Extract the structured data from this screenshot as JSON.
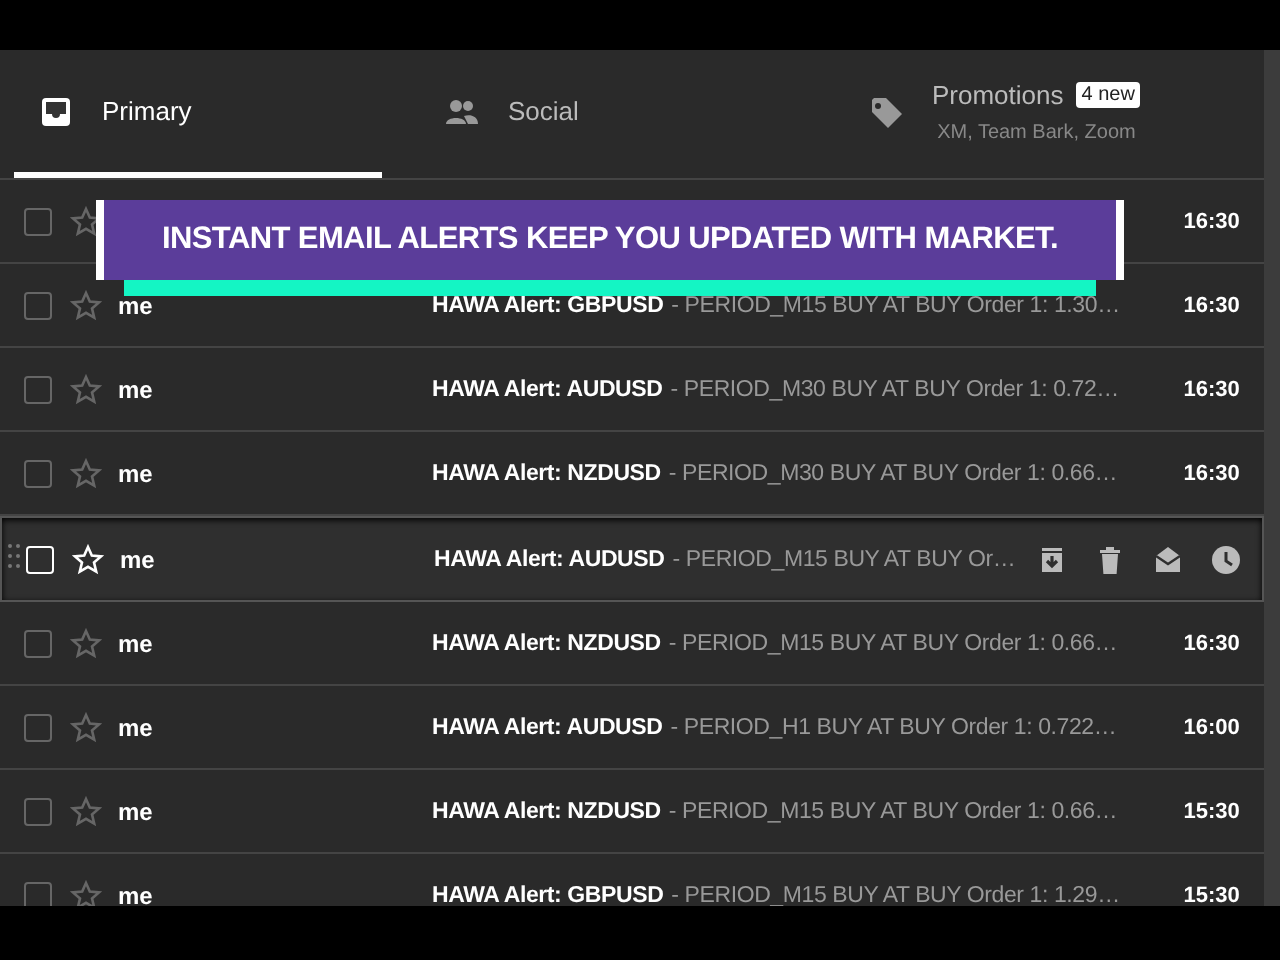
{
  "tabs": [
    {
      "label": "Primary",
      "kind": "inbox",
      "selected": true
    },
    {
      "label": "Social",
      "kind": "people",
      "selected": false
    },
    {
      "label": "Promotions",
      "kind": "tag",
      "selected": false,
      "badge": "4 new",
      "subtitle": "XM, Team Bark, Zoom"
    }
  ],
  "banner": {
    "text": "INSTANT EMAIL ALERTS KEEP YOU UPDATED WITH MARKET."
  },
  "emails": [
    {
      "time": "16:30",
      "hovered": false,
      "checked": false,
      "starred": false
    },
    {
      "sender": "me",
      "subject": "HAWA Alert: GBPUSD",
      "snippet": "- PERIOD_M15 BUY AT BUY Order 1: 1.30…",
      "time": "16:30",
      "hovered": false,
      "checked": false,
      "starred": false
    },
    {
      "sender": "me",
      "subject": "HAWA Alert: AUDUSD",
      "snippet": "- PERIOD_M30 BUY AT BUY Order 1: 0.72…",
      "time": "16:30",
      "hovered": false,
      "checked": false,
      "starred": false
    },
    {
      "sender": "me",
      "subject": "HAWA Alert: NZDUSD",
      "snippet": "- PERIOD_M30 BUY AT BUY Order 1: 0.66…",
      "time": "16:30",
      "hovered": false,
      "checked": false,
      "starred": false
    },
    {
      "sender": "me",
      "subject": "HAWA Alert: AUDUSD",
      "snippet": "- PERIOD_M15 BUY AT BUY Or…",
      "hovered": true,
      "checked": false,
      "starred": false
    },
    {
      "sender": "me",
      "subject": "HAWA Alert: NZDUSD",
      "snippet": "- PERIOD_M15 BUY AT BUY Order 1: 0.66…",
      "time": "16:30",
      "hovered": false,
      "checked": false,
      "starred": false
    },
    {
      "sender": "me",
      "subject": "HAWA Alert: AUDUSD",
      "snippet": "- PERIOD_H1 BUY AT BUY Order 1: 0.722…",
      "time": "16:00",
      "hovered": false,
      "checked": false,
      "starred": false
    },
    {
      "sender": "me",
      "subject": "HAWA Alert: NZDUSD",
      "snippet": "- PERIOD_M15 BUY AT BUY Order 1: 0.66…",
      "time": "15:30",
      "hovered": false,
      "checked": false,
      "starred": false
    },
    {
      "sender": "me",
      "subject": "HAWA Alert: GBPUSD",
      "snippet": "- PERIOD_M15 BUY AT BUY Order 1: 1.29…",
      "time": "15:30",
      "hovered": false,
      "checked": false,
      "starred": false
    }
  ]
}
